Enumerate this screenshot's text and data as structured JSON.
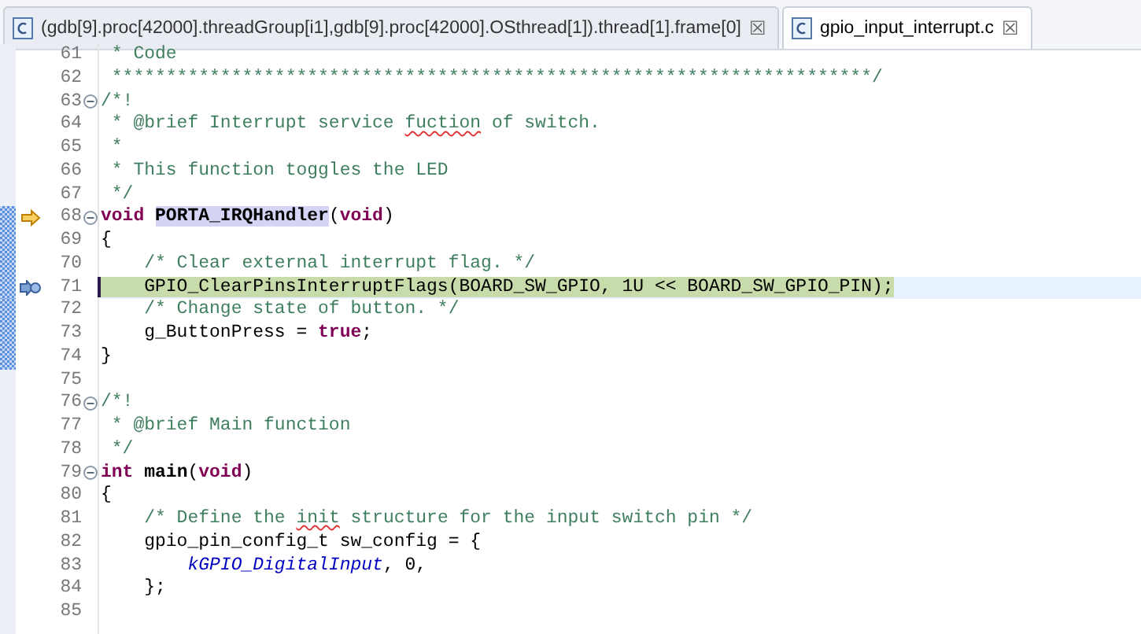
{
  "tabs": [
    {
      "label": "(gdb[9].proc[42000].threadGroup[i1],gdb[9].proc[42000].OSthread[1]).thread[1].frame[0]",
      "close": "☒",
      "selected": false
    },
    {
      "label": "gpio_input_interrupt.c",
      "close": "☒",
      "selected": true
    }
  ],
  "lines": [
    {
      "number": "61",
      "segments": [
        {
          "kind": "comment",
          "text": " * Code"
        }
      ]
    },
    {
      "number": "62",
      "segments": [
        {
          "kind": "comment",
          "text": " **********************************************************************/"
        }
      ]
    },
    {
      "number": "63",
      "fold": true,
      "segments": [
        {
          "kind": "comment",
          "text": "/*!"
        }
      ]
    },
    {
      "number": "64",
      "segments": [
        {
          "kind": "comment",
          "text": " * @brief Interrupt service "
        },
        {
          "kind": "misspelled",
          "text": "fuction"
        },
        {
          "kind": "comment",
          "text": " of switch."
        }
      ]
    },
    {
      "number": "65",
      "segments": [
        {
          "kind": "comment",
          "text": " *"
        }
      ]
    },
    {
      "number": "66",
      "segments": [
        {
          "kind": "comment",
          "text": " * This function toggles the LED"
        }
      ]
    },
    {
      "number": "67",
      "segments": [
        {
          "kind": "comment",
          "text": " */"
        }
      ]
    },
    {
      "number": "68",
      "fold": true,
      "instruction_pointer": true,
      "range": true,
      "segments": [
        {
          "kind": "keyword",
          "text": "void "
        },
        {
          "kind": "occurrence",
          "text": "PORTA_IRQHandler"
        },
        {
          "kind": "plain",
          "text": "("
        },
        {
          "kind": "keyword",
          "text": "void"
        },
        {
          "kind": "plain",
          "text": ")"
        }
      ]
    },
    {
      "number": "69",
      "range": true,
      "segments": [
        {
          "kind": "plain",
          "text": "{"
        }
      ]
    },
    {
      "number": "70",
      "range": true,
      "segments": [
        {
          "kind": "comment",
          "text": "    /* Clear external interrupt flag. */"
        }
      ]
    },
    {
      "number": "71",
      "range": true,
      "stack_frame": true,
      "current": true,
      "segments": [
        {
          "kind": "plain",
          "text": "    GPIO_ClearPinsInterruptFlags(BOARD_SW_GPIO, 1U << BOARD_SW_GPIO_PIN);"
        }
      ]
    },
    {
      "number": "72",
      "range": true,
      "segments": [
        {
          "kind": "comment",
          "text": "    /* Change state of button. */"
        }
      ]
    },
    {
      "number": "73",
      "range": true,
      "segments": [
        {
          "kind": "plain",
          "text": "    g_ButtonPress = "
        },
        {
          "kind": "keyword",
          "text": "true"
        },
        {
          "kind": "plain",
          "text": ";"
        }
      ]
    },
    {
      "number": "74",
      "range": true,
      "segments": [
        {
          "kind": "plain",
          "text": "}"
        }
      ]
    },
    {
      "number": "75"
    },
    {
      "number": "76",
      "fold": true,
      "segments": [
        {
          "kind": "comment",
          "text": "/*!"
        }
      ]
    },
    {
      "number": "77",
      "segments": [
        {
          "kind": "comment",
          "text": " * @brief Main function"
        }
      ]
    },
    {
      "number": "78",
      "segments": [
        {
          "kind": "comment",
          "text": " */"
        }
      ]
    },
    {
      "number": "79",
      "fold": true,
      "segments": [
        {
          "kind": "keyword",
          "text": "int "
        },
        {
          "kind": "bold",
          "text": "main"
        },
        {
          "kind": "plain",
          "text": "("
        },
        {
          "kind": "keyword",
          "text": "void"
        },
        {
          "kind": "plain",
          "text": ")"
        }
      ]
    },
    {
      "number": "80",
      "segments": [
        {
          "kind": "plain",
          "text": "{"
        }
      ]
    },
    {
      "number": "81",
      "segments": [
        {
          "kind": "comment",
          "text": "    /* Define the "
        },
        {
          "kind": "misspelled",
          "text": "init"
        },
        {
          "kind": "comment",
          "text": " structure for the input switch pin */"
        }
      ]
    },
    {
      "number": "82",
      "segments": [
        {
          "kind": "plain",
          "text": "    gpio_pin_config_t sw_config = {"
        }
      ]
    },
    {
      "number": "83",
      "segments": [
        {
          "kind": "constant",
          "text": "        kGPIO_DigitalInput"
        },
        {
          "kind": "plain",
          "text": ", 0,"
        }
      ]
    },
    {
      "number": "84",
      "segments": [
        {
          "kind": "plain",
          "text": "    };"
        }
      ]
    },
    {
      "number": "85"
    }
  ]
}
